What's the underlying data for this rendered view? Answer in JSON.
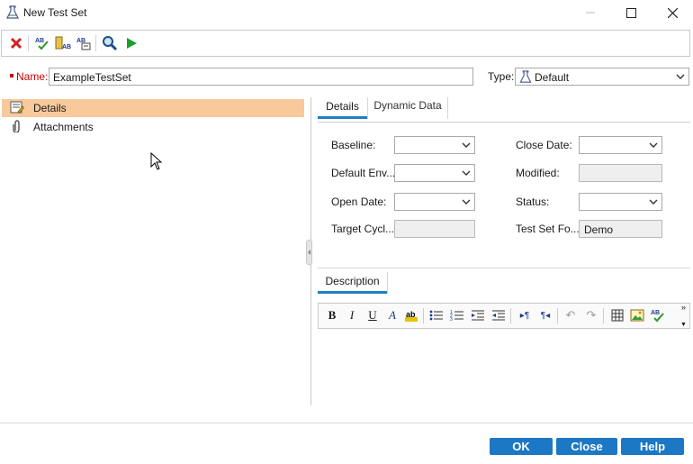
{
  "window": {
    "title": "New Test Set"
  },
  "toolbar": {
    "buttons": [
      "delete-icon",
      "spell-check-icon",
      "thesaurus-icon",
      "spell-options-icon",
      "find-icon",
      "run-icon"
    ]
  },
  "name_row": {
    "name_label": "Name:",
    "name_value": "ExampleTestSet",
    "type_label": "Type:",
    "type_value": "Default"
  },
  "sidebar": {
    "items": [
      {
        "label": "Details",
        "icon": "details-icon",
        "selected": true
      },
      {
        "label": "Attachments",
        "icon": "paperclip-icon",
        "selected": false
      }
    ]
  },
  "tabs": [
    {
      "label": "Details",
      "active": true
    },
    {
      "label": "Dynamic Data",
      "active": false
    }
  ],
  "form": {
    "baseline_label": "Baseline:",
    "baseline_value": "",
    "default_env_label": "Default Env...",
    "default_env_value": "",
    "open_date_label": "Open Date:",
    "open_date_value": "",
    "target_cycle_label": "Target Cycl...",
    "target_cycle_value": "",
    "close_date_label": "Close Date:",
    "close_date_value": "",
    "modified_label": "Modified:",
    "modified_value": "",
    "status_label": "Status:",
    "status_value": "",
    "test_set_folder_label": "Test Set Fo...",
    "test_set_folder_value": "Demo"
  },
  "description": {
    "tab_label": "Description",
    "toolbar": [
      "bold-icon",
      "italic-icon",
      "underline-icon",
      "font-color-icon",
      "highlight-icon",
      "bullet-list-icon",
      "numbered-list-icon",
      "indent-icon",
      "outdent-icon",
      "ltr-icon",
      "rtl-icon",
      "undo-icon",
      "redo-icon",
      "table-icon",
      "image-icon",
      "spell-check-icon",
      "more-icon"
    ]
  },
  "footer": {
    "ok_label": "OK",
    "close_label": "Close",
    "help_label": "Help"
  },
  "colors": {
    "selection": "#f8c99a",
    "accent": "#1f7fc1",
    "button": "#1c78c4",
    "required_marker": "#cc0000"
  }
}
